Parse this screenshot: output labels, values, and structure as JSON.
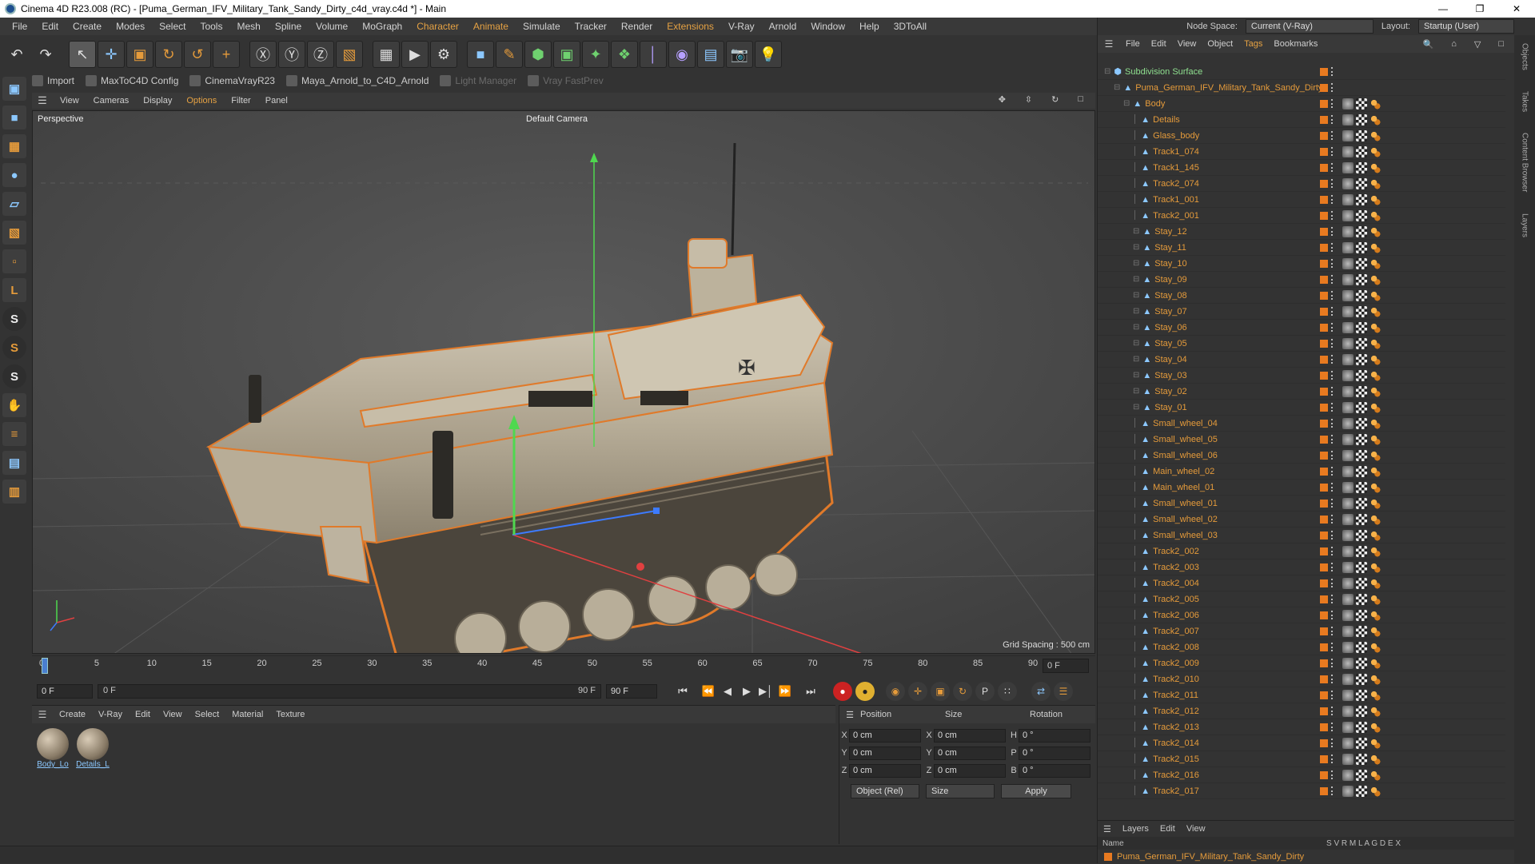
{
  "window": {
    "title": "Cinema 4D R23.008 (RC) - [Puma_German_IFV_Military_Tank_Sandy_Dirty_c4d_vray.c4d *] - Main"
  },
  "menubar": {
    "items": [
      "File",
      "Edit",
      "Create",
      "Modes",
      "Select",
      "Tools",
      "Mesh",
      "Spline",
      "Volume",
      "MoGraph",
      "Character",
      "Animate",
      "Simulate",
      "Tracker",
      "Render",
      "Extensions",
      "V-Ray",
      "Arnold",
      "Window",
      "Help",
      "3DToAll"
    ]
  },
  "pluginbar": {
    "items": [
      "Import",
      "MaxToC4D Config",
      "CinemaVrayR23",
      "Maya_Arnold_to_C4D_Arnold",
      "Light Manager",
      "Vray FastPrev"
    ]
  },
  "viewport": {
    "menu": [
      "View",
      "Cameras",
      "Display",
      "Options",
      "Filter",
      "Panel"
    ],
    "label": "Perspective",
    "camera": "Default Camera",
    "grid_spacing": "Grid Spacing : 500 cm"
  },
  "timeline": {
    "ticks": [
      "0",
      "5",
      "10",
      "15",
      "20",
      "25",
      "30",
      "35",
      "40",
      "45",
      "50",
      "55",
      "60",
      "65",
      "70",
      "75",
      "80",
      "85",
      "90"
    ],
    "current_frame": "0 F"
  },
  "transport": {
    "start": "0 F",
    "current": "0 F",
    "end_a": "90 F",
    "end_b": "90 F"
  },
  "material_manager": {
    "menu": [
      "Create",
      "V-Ray",
      "Edit",
      "View",
      "Select",
      "Material",
      "Texture"
    ],
    "materials": [
      "Body_Lo",
      "Details_L"
    ]
  },
  "attributes": {
    "headers": [
      "Position",
      "Size",
      "Rotation"
    ],
    "rows": [
      {
        "axis1": "X",
        "pos": "0 cm",
        "axis2": "X",
        "size": "0 cm",
        "axis3": "H",
        "rot": "0 °"
      },
      {
        "axis1": "Y",
        "pos": "0 cm",
        "axis2": "Y",
        "size": "0 cm",
        "axis3": "P",
        "rot": "0 °"
      },
      {
        "axis1": "Z",
        "pos": "0 cm",
        "axis2": "Z",
        "size": "0 cm",
        "axis3": "B",
        "rot": "0 °"
      }
    ],
    "coord_mode": "Object (Rel)",
    "size_mode": "Size",
    "apply": "Apply"
  },
  "right_panel": {
    "node_space_label": "Node Space:",
    "node_space_value": "Current (V-Ray)",
    "layout_label": "Layout:",
    "layout_value": "Startup (User)",
    "menu": [
      "File",
      "Edit",
      "View",
      "Object",
      "Tags",
      "Bookmarks"
    ],
    "side_tabs": [
      "Objects",
      "Takes",
      "Content Browser",
      "Layers"
    ]
  },
  "objects": [
    {
      "name": "Subdivision Surface",
      "depth": 0
    },
    {
      "name": "Puma_German_IFV_Military_Tank_Sandy_Dirty",
      "depth": 1
    },
    {
      "name": "Body",
      "depth": 2
    },
    {
      "name": "Details",
      "depth": 3
    },
    {
      "name": "Glass_body",
      "depth": 3
    },
    {
      "name": "Track1_074",
      "depth": 3
    },
    {
      "name": "Track1_145",
      "depth": 3
    },
    {
      "name": "Track2_074",
      "depth": 3
    },
    {
      "name": "Track1_001",
      "depth": 3
    },
    {
      "name": "Track2_001",
      "depth": 3
    },
    {
      "name": "Stay_12",
      "depth": 3
    },
    {
      "name": "Stay_11",
      "depth": 3
    },
    {
      "name": "Stay_10",
      "depth": 3
    },
    {
      "name": "Stay_09",
      "depth": 3
    },
    {
      "name": "Stay_08",
      "depth": 3
    },
    {
      "name": "Stay_07",
      "depth": 3
    },
    {
      "name": "Stay_06",
      "depth": 3
    },
    {
      "name": "Stay_05",
      "depth": 3
    },
    {
      "name": "Stay_04",
      "depth": 3
    },
    {
      "name": "Stay_03",
      "depth": 3
    },
    {
      "name": "Stay_02",
      "depth": 3
    },
    {
      "name": "Stay_01",
      "depth": 3
    },
    {
      "name": "Small_wheel_04",
      "depth": 3
    },
    {
      "name": "Small_wheel_05",
      "depth": 3
    },
    {
      "name": "Small_wheel_06",
      "depth": 3
    },
    {
      "name": "Main_wheel_02",
      "depth": 3
    },
    {
      "name": "Main_wheel_01",
      "depth": 3
    },
    {
      "name": "Small_wheel_01",
      "depth": 3
    },
    {
      "name": "Small_wheel_02",
      "depth": 3
    },
    {
      "name": "Small_wheel_03",
      "depth": 3
    },
    {
      "name": "Track2_002",
      "depth": 3
    },
    {
      "name": "Track2_003",
      "depth": 3
    },
    {
      "name": "Track2_004",
      "depth": 3
    },
    {
      "name": "Track2_005",
      "depth": 3
    },
    {
      "name": "Track2_006",
      "depth": 3
    },
    {
      "name": "Track2_007",
      "depth": 3
    },
    {
      "name": "Track2_008",
      "depth": 3
    },
    {
      "name": "Track2_009",
      "depth": 3
    },
    {
      "name": "Track2_010",
      "depth": 3
    },
    {
      "name": "Track2_011",
      "depth": 3
    },
    {
      "name": "Track2_012",
      "depth": 3
    },
    {
      "name": "Track2_013",
      "depth": 3
    },
    {
      "name": "Track2_014",
      "depth": 3
    },
    {
      "name": "Track2_015",
      "depth": 3
    },
    {
      "name": "Track2_016",
      "depth": 3
    },
    {
      "name": "Track2_017",
      "depth": 3
    }
  ],
  "layers": {
    "menu": [
      "Layers",
      "Edit",
      "View"
    ],
    "columns": "Name",
    "flags": "S V R M L A G D E X",
    "row": "Puma_German_IFV_Military_Tank_Sandy_Dirty"
  },
  "colors": {
    "accent_orange": "#e59b3b",
    "layer_orange": "#e87a20",
    "link_blue": "#8cc8ff"
  }
}
